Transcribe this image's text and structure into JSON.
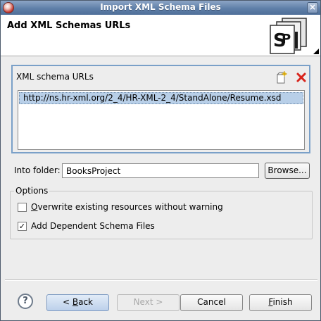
{
  "window": {
    "title": "Import XML Schema Files"
  },
  "header": {
    "title": "Add XML Schemas URLs",
    "icon": "schema-wizard-icon"
  },
  "url_group": {
    "label": "XML schema URLs",
    "toolbar": {
      "add_icon": "add-url-icon",
      "remove_icon": "remove-url-icon"
    },
    "urls": [
      "http://ns.hr-xml.org/2_4/HR-XML-2_4/StandAlone/Resume.xsd"
    ]
  },
  "folder": {
    "label": "Into folder:",
    "value": "BooksProject",
    "browse_label": "Browse..."
  },
  "options": {
    "label": "Options",
    "overwrite": {
      "label": "Overwrite existing resources without warning",
      "checked": false
    },
    "dependent": {
      "label": "Add Dependent Schema Files",
      "checked": true
    }
  },
  "footer": {
    "help_label": "?",
    "back_label": "< Back",
    "next_label": "Next >",
    "cancel_label": "Cancel",
    "finish_label": "Finish"
  },
  "colors": {
    "titlebar": "#5f7fa8",
    "selection": "#b8cfe8",
    "group_border": "#7aa0c8",
    "delete_icon": "#d8241c"
  }
}
